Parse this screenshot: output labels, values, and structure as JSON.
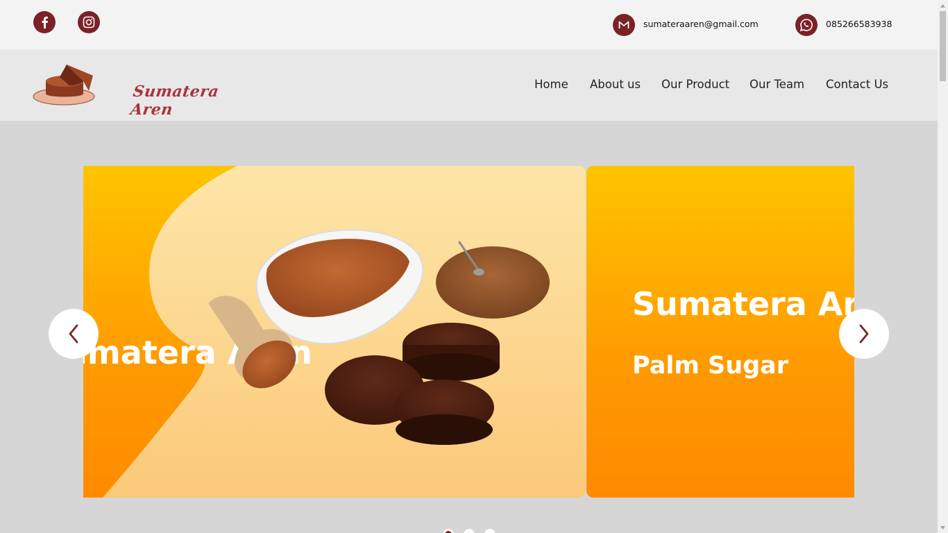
{
  "topbar": {
    "social": [
      {
        "icon": "facebook-icon"
      },
      {
        "icon": "instagram-icon"
      }
    ],
    "email": "sumateraaren@gmail.com",
    "phone": "085266583938"
  },
  "header": {
    "logo_text": "Sumatera Aren",
    "nav": [
      {
        "label": "Home"
      },
      {
        "label": "About us"
      },
      {
        "label": "Our Product"
      },
      {
        "label": "Our Team"
      },
      {
        "label": "Contact Us"
      }
    ]
  },
  "carousel": {
    "slides": [
      {
        "title": "Sumatera Aren",
        "image": "palm-sugar-products"
      },
      {
        "title": "Sumatera Aren",
        "subtitle": "Palm Sugar"
      }
    ],
    "active_index": 0,
    "dot_count": 3
  },
  "colors": {
    "brand": "#7b2226",
    "accent_orange": "#ff9a00",
    "accent_yellow": "#ffc400",
    "logo_text": "#a8343a"
  }
}
